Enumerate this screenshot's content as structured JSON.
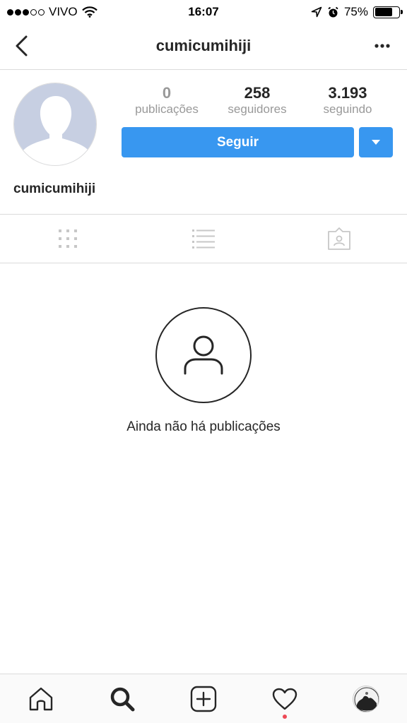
{
  "status_bar": {
    "carrier": "VIVO",
    "time": "16:07",
    "battery_percent": "75%",
    "battery_level": 0.75,
    "signal_bars_filled": 3,
    "signal_bars_total": 5
  },
  "nav": {
    "title": "cumicumihiji",
    "back_icon": "chevron-left-icon",
    "more_icon": "more-horizontal-icon"
  },
  "profile": {
    "username": "cumicumihiji",
    "stats": [
      {
        "value": "0",
        "label": "publicações"
      },
      {
        "value": "258",
        "label": "seguidores"
      },
      {
        "value": "3.193",
        "label": "seguindo"
      }
    ],
    "follow_label": "Seguir"
  },
  "tabs": [
    {
      "name": "grid-icon",
      "active": false
    },
    {
      "name": "list-icon",
      "active": false
    },
    {
      "name": "tagged-icon",
      "active": false
    }
  ],
  "empty_state": {
    "icon": "user-icon",
    "text": "Ainda não há publicações"
  },
  "bottom_nav": [
    {
      "name": "home-icon"
    },
    {
      "name": "search-icon",
      "active": true
    },
    {
      "name": "add-icon"
    },
    {
      "name": "heart-icon",
      "has_notification": true
    },
    {
      "name": "profile-avatar"
    }
  ],
  "colors": {
    "accent": "#3897f0",
    "text": "#262626",
    "muted": "#999999",
    "border": "#dbdbdb",
    "notification": "#ed4956"
  }
}
